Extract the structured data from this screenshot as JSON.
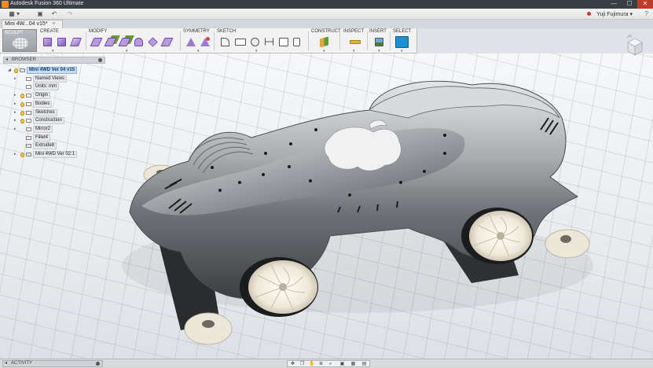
{
  "window": {
    "title": "Autodesk Fusion 360 Ultimate",
    "minimize": "—",
    "maximize": "☐",
    "close": "✕"
  },
  "qat": {
    "grid_icon": "▦",
    "dropdown": "▾",
    "save_icon": "▣",
    "undo_icon": "↶",
    "redo_icon": "↷",
    "user": "Yuji Fujimura ▾",
    "help": "?"
  },
  "document_tab": {
    "label": "Mini 4W...04 v15*",
    "close": "×"
  },
  "ribbon": {
    "workspace": "SCULPT",
    "groups": {
      "create": "CREATE",
      "modify": "MODIFY",
      "symmetry": "SYMMETRY",
      "sketch": "SKETCH",
      "construct": "CONSTRUCT",
      "inspect": "INSPECT",
      "insert": "INSERT",
      "select": "SELECT"
    },
    "caret": "▾"
  },
  "browser": {
    "header": "BROWSER",
    "collapse": "◂",
    "tree": [
      {
        "label": "Mini 4WD Ver 04 v15",
        "twisty": "◢"
      },
      {
        "label": "Named Views",
        "twisty": "▸"
      },
      {
        "label": "Units: mm",
        "twisty": ""
      },
      {
        "label": "Origin",
        "twisty": "▸"
      },
      {
        "label": "Bodies",
        "twisty": "▸"
      },
      {
        "label": "Sketches",
        "twisty": "▸"
      },
      {
        "label": "Construction",
        "twisty": "▸"
      },
      {
        "label": "Mirror2",
        "twisty": "▸"
      },
      {
        "label": "Fillet4",
        "twisty": ""
      },
      {
        "label": "Extrude8",
        "twisty": ""
      },
      {
        "label": "Mini 4WD Ver 02:1",
        "twisty": "▸"
      }
    ]
  },
  "bottom": {
    "activity": "ACTIVITY",
    "collapse": "◂",
    "nav": [
      "✥",
      "❐",
      "✋",
      "⊕",
      "⌕",
      "▣",
      "▦",
      "▤"
    ]
  },
  "colors": {
    "accent": "#0696d7",
    "titlebar": "#3a3f45",
    "body_metal": "#9b9ea1",
    "wheel": "#f2ede0"
  }
}
